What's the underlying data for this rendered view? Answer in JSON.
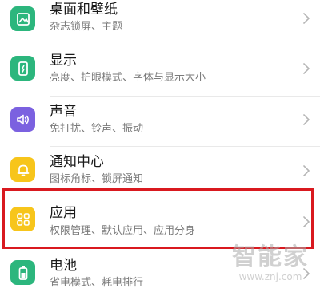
{
  "colors": {
    "green": "#2cb67d",
    "purple": "#7b61e0",
    "yellow": "#f7c51b",
    "highlight": "#d9191f"
  },
  "items": [
    {
      "title": "桌面和壁纸",
      "subtitle": "杂志锁屏、主题",
      "icon": "wallpaper-icon",
      "color": "#2cb67d"
    },
    {
      "title": "显示",
      "subtitle": "亮度、护眼模式、字体与显示大小",
      "icon": "display-icon",
      "color": "#2cb67d"
    },
    {
      "title": "声音",
      "subtitle": "免打扰、铃声、振动",
      "icon": "sound-icon",
      "color": "#7b61e0"
    },
    {
      "title": "通知中心",
      "subtitle": "图标角标、锁屏通知",
      "icon": "bell-icon",
      "color": "#f7c51b"
    },
    {
      "title": "应用",
      "subtitle": "权限管理、默认应用、应用分身",
      "icon": "apps-icon",
      "color": "#f7c51b"
    },
    {
      "title": "电池",
      "subtitle": "省电模式、耗电排行",
      "icon": "battery-icon",
      "color": "#2cb67d"
    }
  ],
  "watermark": {
    "text": "智能家",
    "url": "www.znj.com"
  }
}
